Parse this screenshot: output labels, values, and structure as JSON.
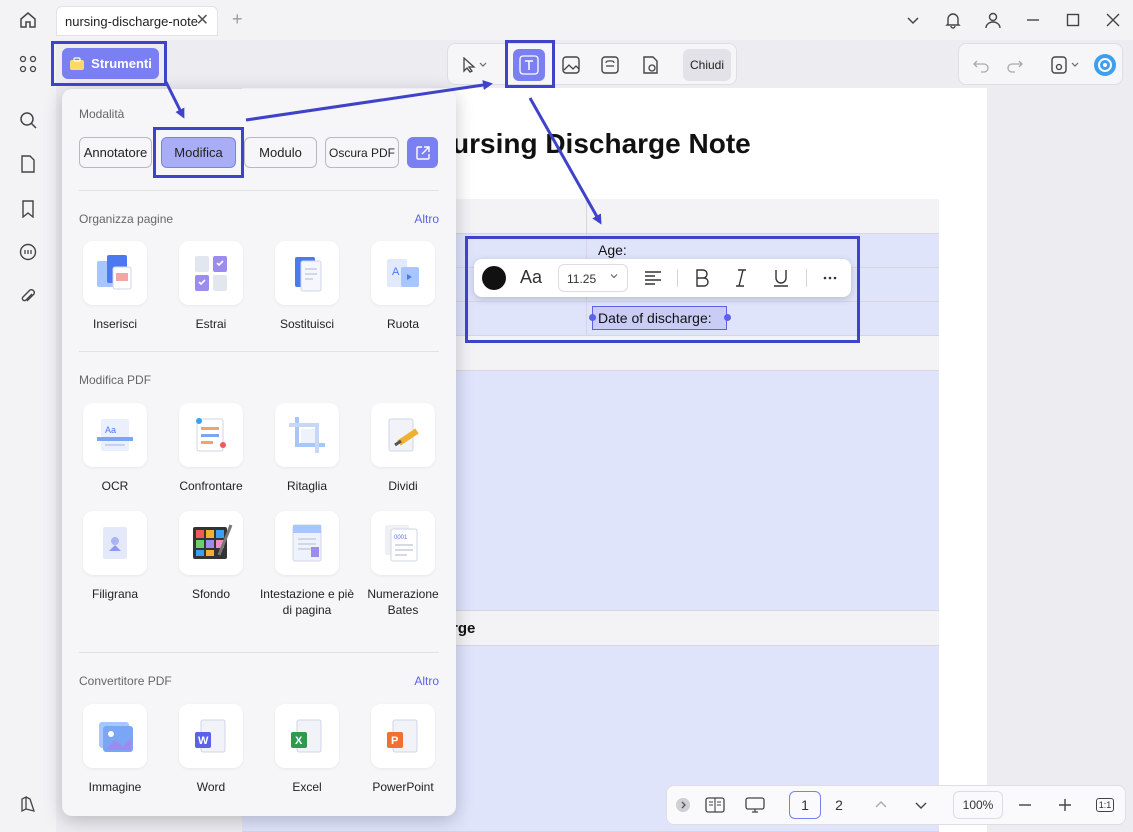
{
  "window": {
    "tab_title": "nursing-discharge-note",
    "tab_close": "✕",
    "new_tab": "+"
  },
  "toolbar": {
    "strumenti_label": "Strumenti",
    "chiudi_label": "Chiudi"
  },
  "document": {
    "title": "ursing Discharge Note",
    "age_label": "Age:",
    "discharge_label": "Date of discharge:",
    "charge_heading": "rge"
  },
  "format_popup": {
    "font_size": "11.25",
    "font_icon": "Aa",
    "text_color": "#111111"
  },
  "tools_panel": {
    "modes_title": "Modalità",
    "modes": [
      "Annotatore",
      "Modifica",
      "Modulo",
      "Oscura PDF"
    ],
    "active_mode": "Modifica",
    "organize_title": "Organizza pagine",
    "organize_more": "Altro",
    "organize_tools": [
      "Inserisci",
      "Estrai",
      "Sostituisci",
      "Ruota"
    ],
    "edit_title": "Modifica PDF",
    "edit_tools": [
      "OCR",
      "Confrontare",
      "Ritaglia",
      "Dividi"
    ],
    "edit_tools_2": [
      "Filigrana",
      "Sfondo",
      "Intestazione e piè di pagina",
      "Numerazione Bates"
    ],
    "convert_title": "Convertitore PDF",
    "convert_more": "Altro",
    "convert_tools": [
      "Immagine",
      "Word",
      "Excel",
      "PowerPoint"
    ]
  },
  "bottom_nav": {
    "page_current": "1",
    "page_next": "2",
    "zoom": "100%",
    "fit_label": "1:1"
  },
  "colors": {
    "accent": "#7a7ff2",
    "highlight": "#3e43c9",
    "row_blue": "#dfe4fb"
  }
}
